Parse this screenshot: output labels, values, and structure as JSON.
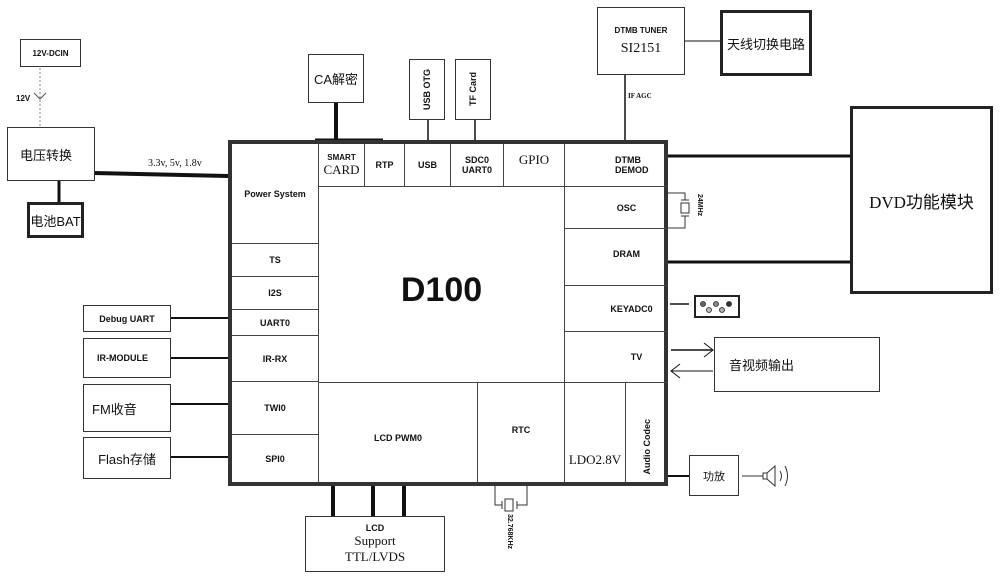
{
  "power": {
    "dcin": "12V-DCIN",
    "dcin_voltage": "12V",
    "converter": "电压转换",
    "battery": "电池BAT",
    "rails": "3.3v, 5v, 1.8v"
  },
  "top_peripherals": {
    "ca": "CA解密",
    "usb_otg": "USB OTG",
    "tf_card": "TF Card",
    "tuner_title": "DTMB TUNER",
    "tuner_part": "SI2151",
    "antenna": "天线切换电路",
    "if_agc": "IF AGC"
  },
  "chip": {
    "name": "D100",
    "top_row": {
      "smart_1": "SMART",
      "smart_2": "CARD",
      "rtp": "RTP",
      "usb": "USB",
      "sdc_1": "SDC0",
      "sdc_2": "UART0",
      "gpio": "GPIO"
    },
    "left_col": {
      "power": "Power System",
      "ts": "TS",
      "i2s": "I2S",
      "uart": "UART0",
      "irrx": "IR-RX",
      "twi": "TWI0",
      "spi": "SPI0"
    },
    "right_col": {
      "dtmb_1": "DTMB",
      "dtmb_2": "DEMOD",
      "osc": "OSC",
      "dram": "DRAM",
      "keyadc": "KEYADC0",
      "tv": "TV",
      "ldo": "LDO2.8V",
      "audio_codec": "Audio Codec"
    },
    "bottom_row": {
      "lcd_pwm": "LCD PWM0",
      "rtc": "RTC"
    }
  },
  "left_peripherals": {
    "debug_uart": "Debug UART",
    "ir_module": "IR-MODULE",
    "fm": "FM收音",
    "flash": "Flash存储"
  },
  "right_peripherals": {
    "crystal_24": "24MHz",
    "dvd": "DVD功能模块",
    "av_out": "音视频输出",
    "amp": "功放"
  },
  "bottom_peripherals": {
    "lcd_1": "LCD",
    "lcd_2": "Support",
    "lcd_3": "TTL/LVDS",
    "crystal_32": "32.768KHz"
  }
}
